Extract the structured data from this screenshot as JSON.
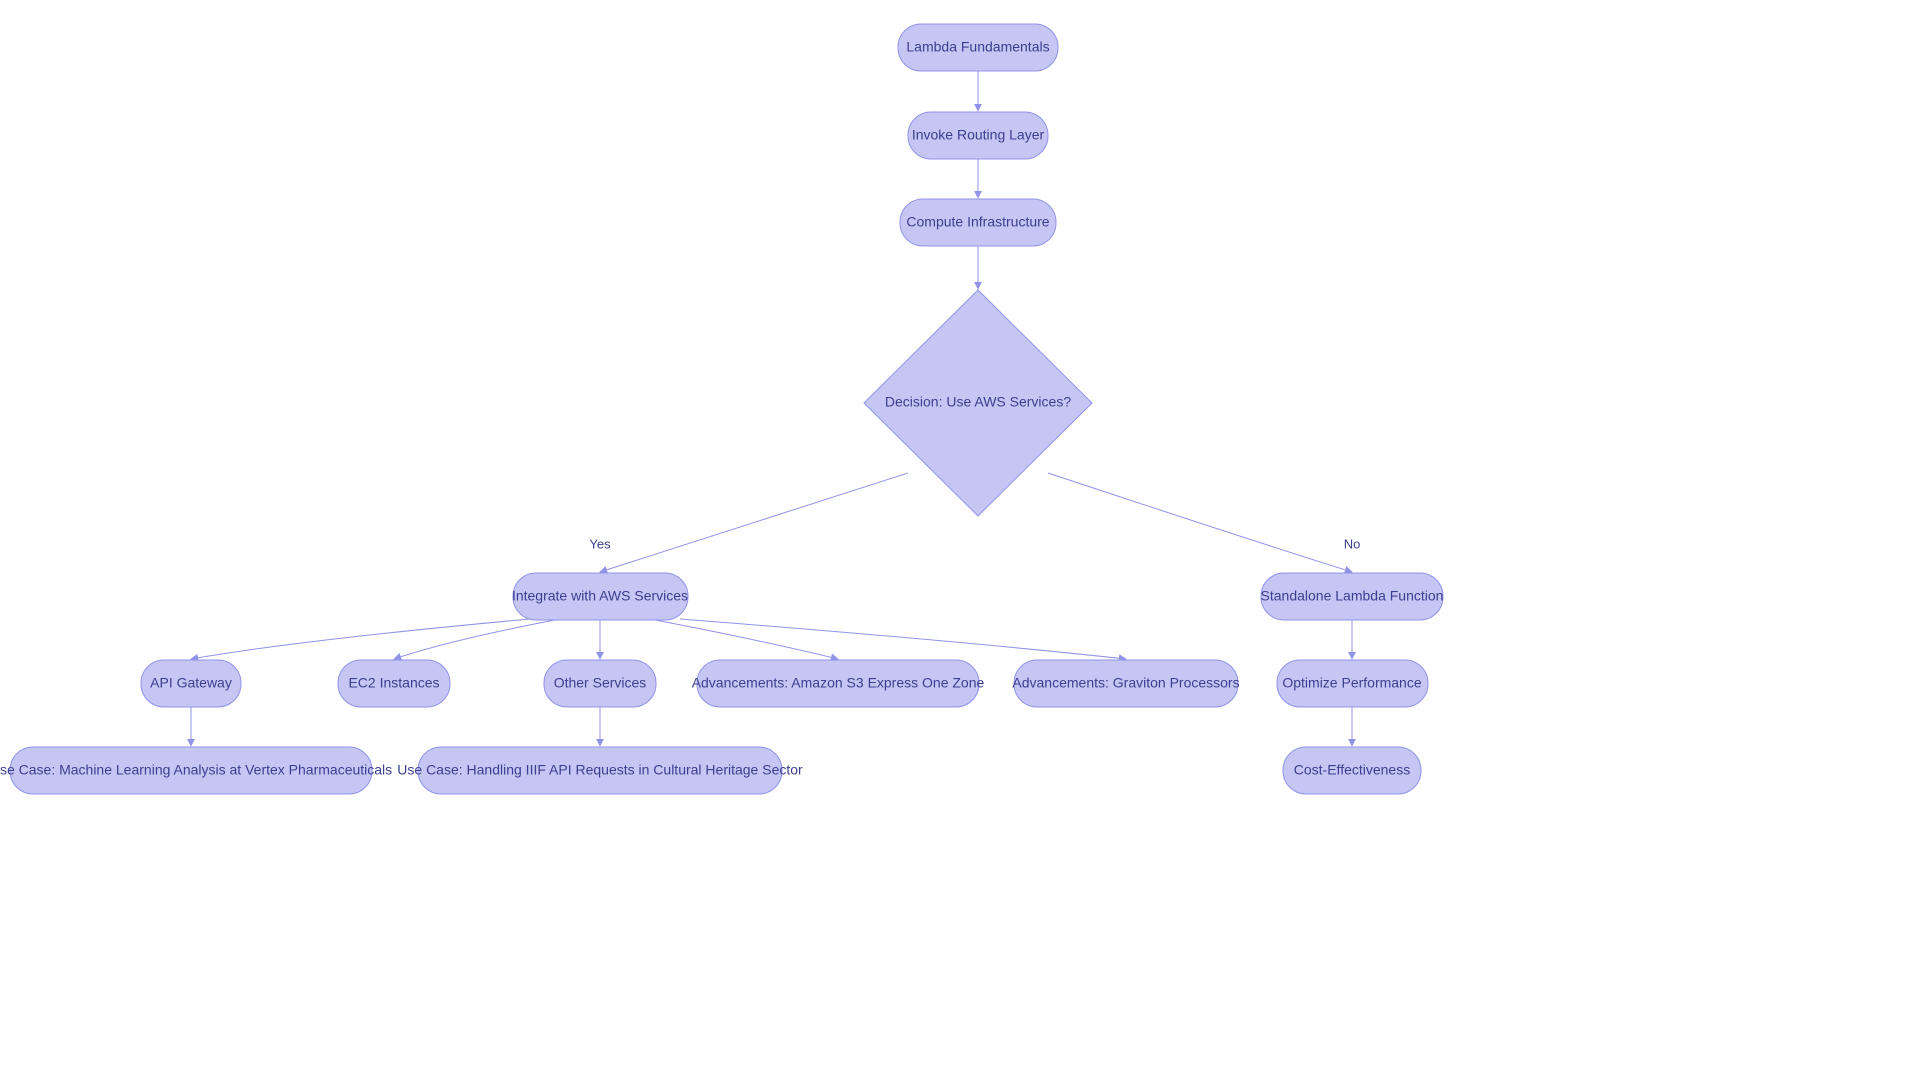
{
  "nodes": {
    "n1": {
      "label": "Lambda Fundamentals"
    },
    "n2": {
      "label": "Invoke Routing Layer"
    },
    "n3": {
      "label": "Compute Infrastructure"
    },
    "n4": {
      "label": "Decision: Use AWS Services?"
    },
    "n5": {
      "label": "Integrate with AWS Services"
    },
    "n6": {
      "label": "Standalone Lambda Function"
    },
    "n7": {
      "label": "API Gateway"
    },
    "n8": {
      "label": "EC2 Instances"
    },
    "n9": {
      "label": "Other Services"
    },
    "n10": {
      "label": "Advancements: Amazon S3 Express One Zone"
    },
    "n11": {
      "label": "Advancements: Graviton Processors"
    },
    "n12": {
      "label": "Optimize Performance"
    },
    "n13": {
      "label": "Cost-Effectiveness"
    },
    "n14": {
      "label": "Use Case: Machine Learning Analysis at Vertex Pharmaceuticals"
    },
    "n15": {
      "label": "Use Case: Handling IIIF API Requests in Cultural Heritage Sector"
    }
  },
  "edges": {
    "yes": "Yes",
    "no": "No"
  },
  "colors": {
    "nodeFill": "#c5c6f3",
    "nodeStroke": "#9093e8",
    "text": "#3b3f8f"
  }
}
